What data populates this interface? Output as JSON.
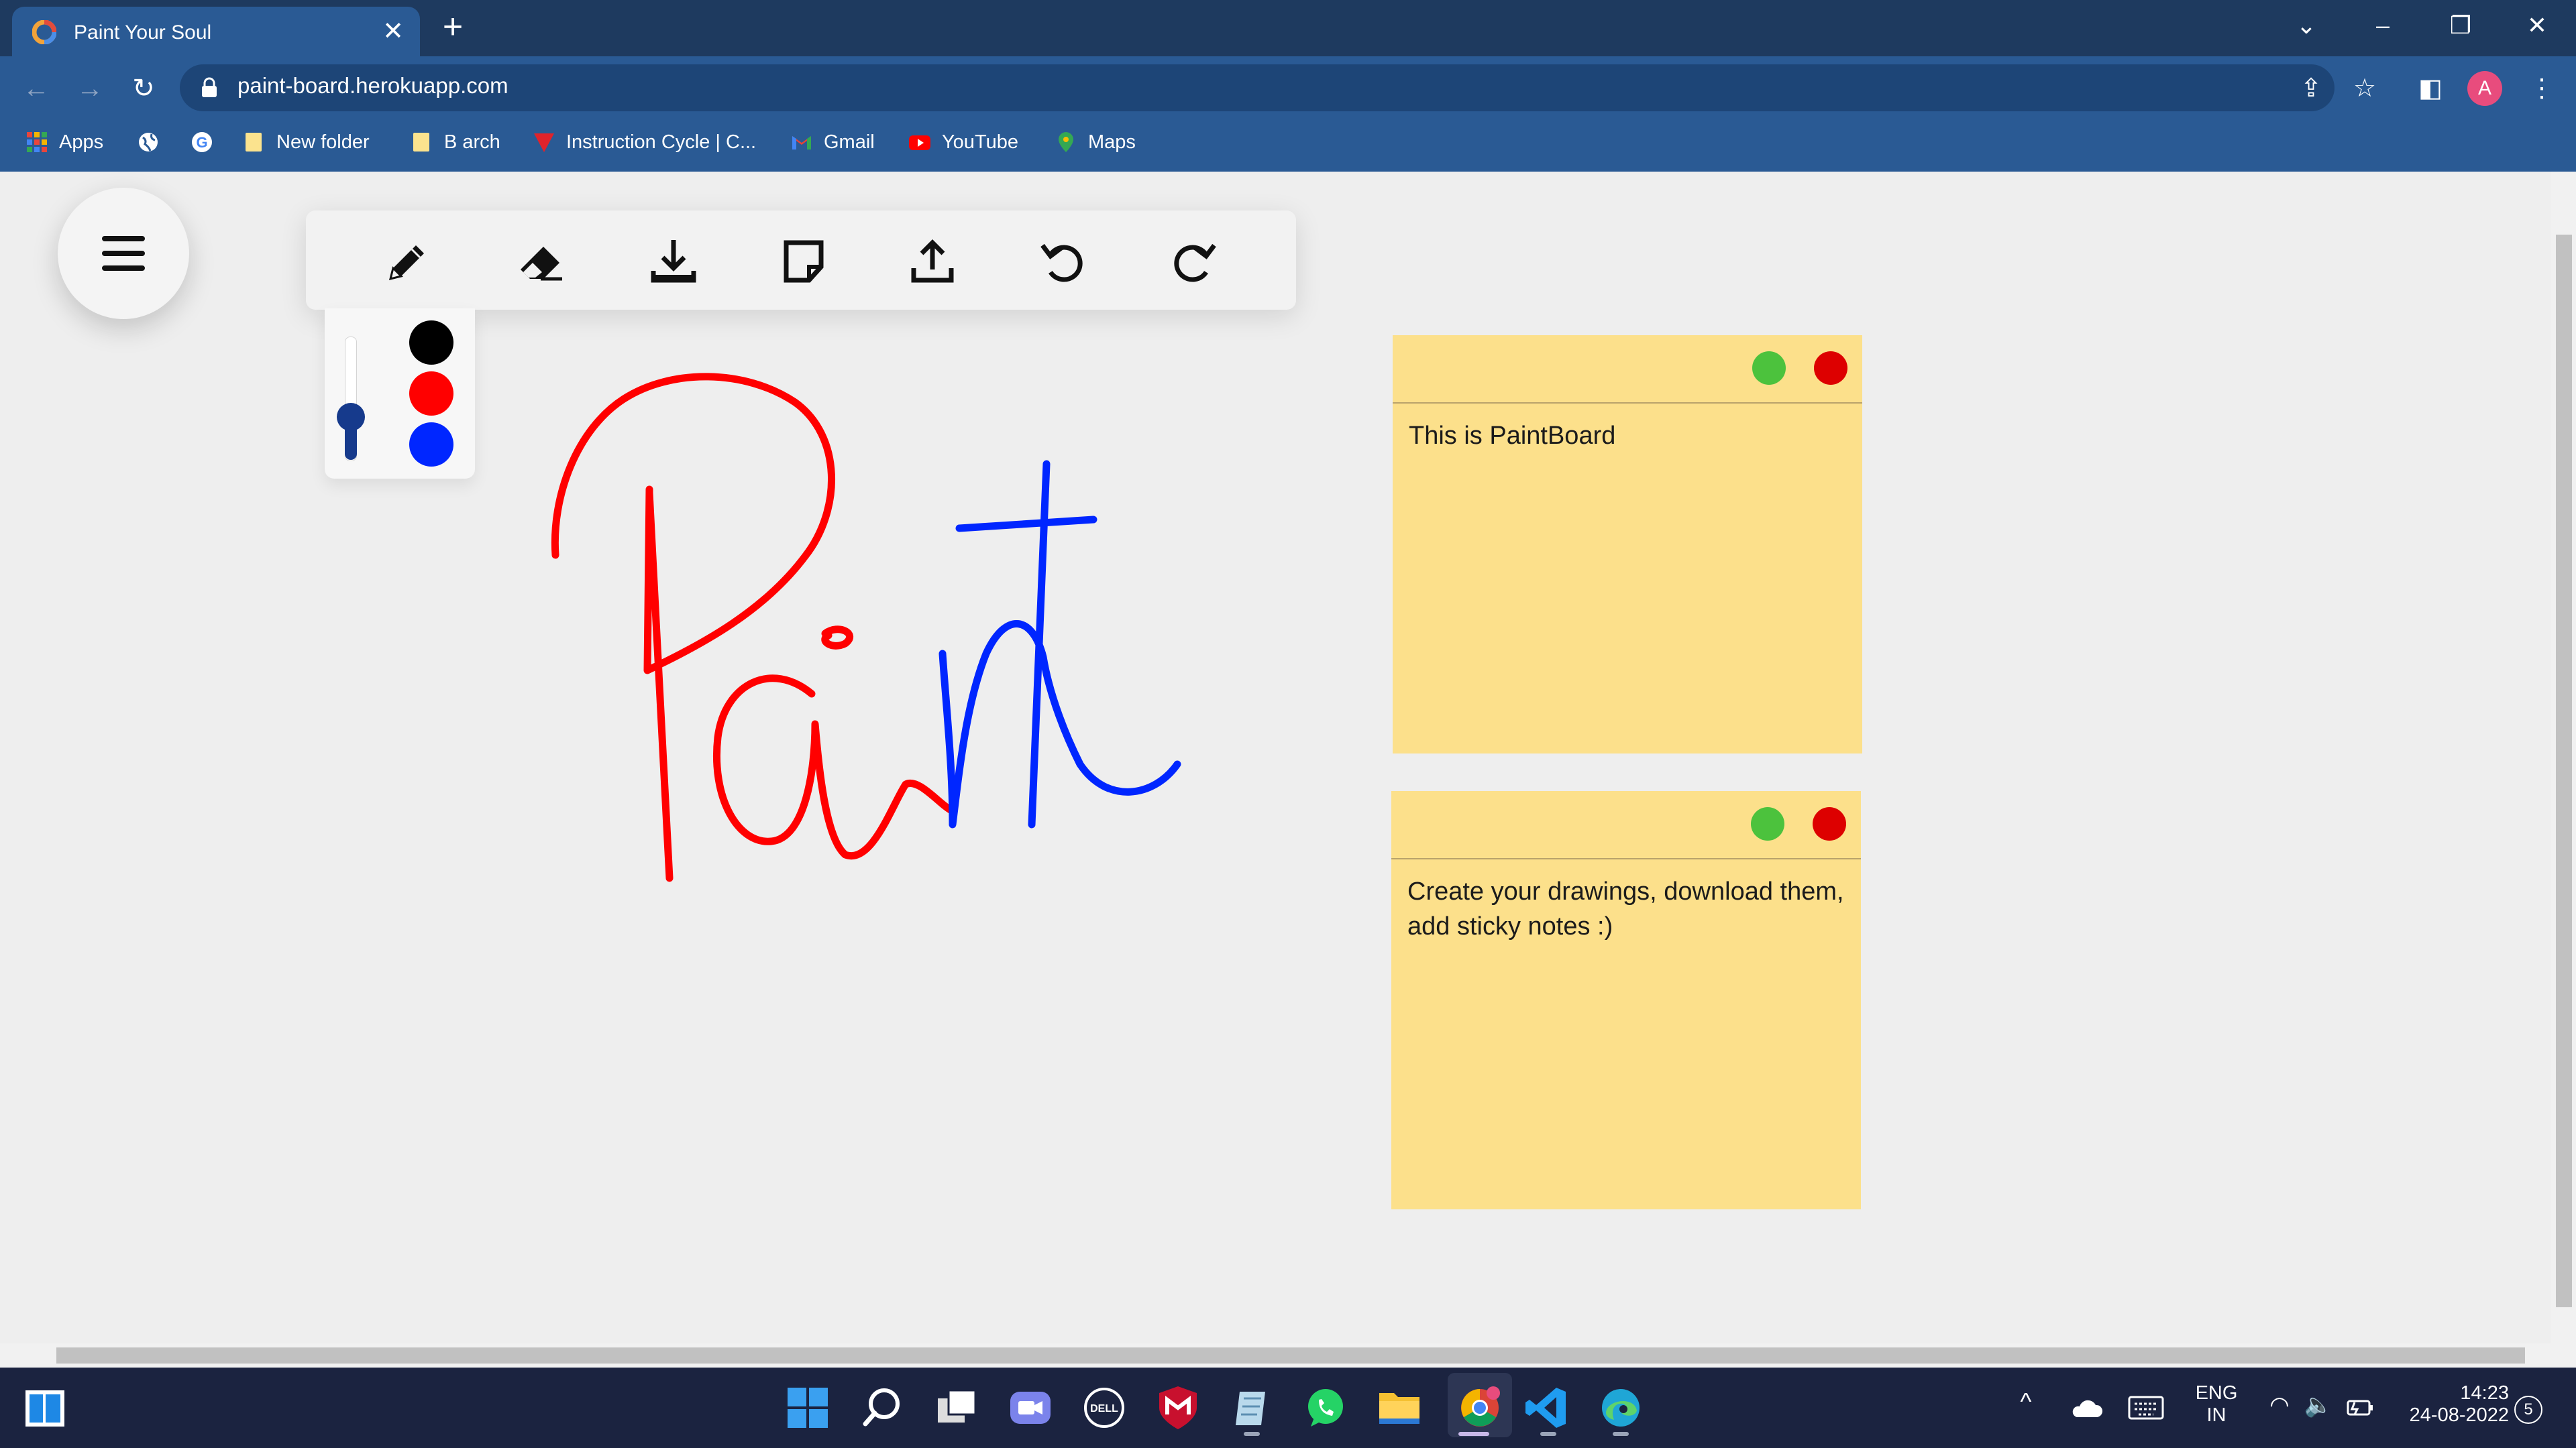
{
  "browser": {
    "tab_title": "Paint Your Soul",
    "tab_close": "✕",
    "new_tab": "+",
    "url": "paint-board.herokuapp.com",
    "profile_initial": "A",
    "bookmarks": [
      "Apps",
      "New folder",
      "B arch",
      "Instruction Cycle | C...",
      "Gmail",
      "YouTube",
      "Maps"
    ]
  },
  "toolbar": {
    "tools": [
      "pencil-icon",
      "eraser-icon",
      "download-icon",
      "sticky-note-icon",
      "upload-icon",
      "undo-icon",
      "redo-icon"
    ]
  },
  "palette": {
    "colors": [
      "#000000",
      "#ff0000",
      "#0026ff"
    ],
    "brush_size_fraction": 0.35,
    "accent": "#163a8c"
  },
  "notes": [
    {
      "text": "This is PaintBoard",
      "minimize_color": "#4cc23d",
      "close_color": "#dd0000"
    },
    {
      "text": "Create your drawings, download them, add sticky notes :)",
      "minimize_color": "#4cc23d",
      "close_color": "#dd0000"
    }
  ],
  "drawing": {
    "strokes": [
      {
        "color": "#ff0000",
        "name": "red-stroke-P"
      },
      {
        "color": "#ff0000",
        "name": "red-stroke-a"
      },
      {
        "color": "#0026ff",
        "name": "blue-stroke-n"
      },
      {
        "color": "#0026ff",
        "name": "blue-stroke-t"
      }
    ]
  },
  "taskbar": {
    "language_line1": "ENG",
    "language_line2": "IN",
    "time": "14:23",
    "date": "24-08-2022",
    "notification_count": "5"
  }
}
